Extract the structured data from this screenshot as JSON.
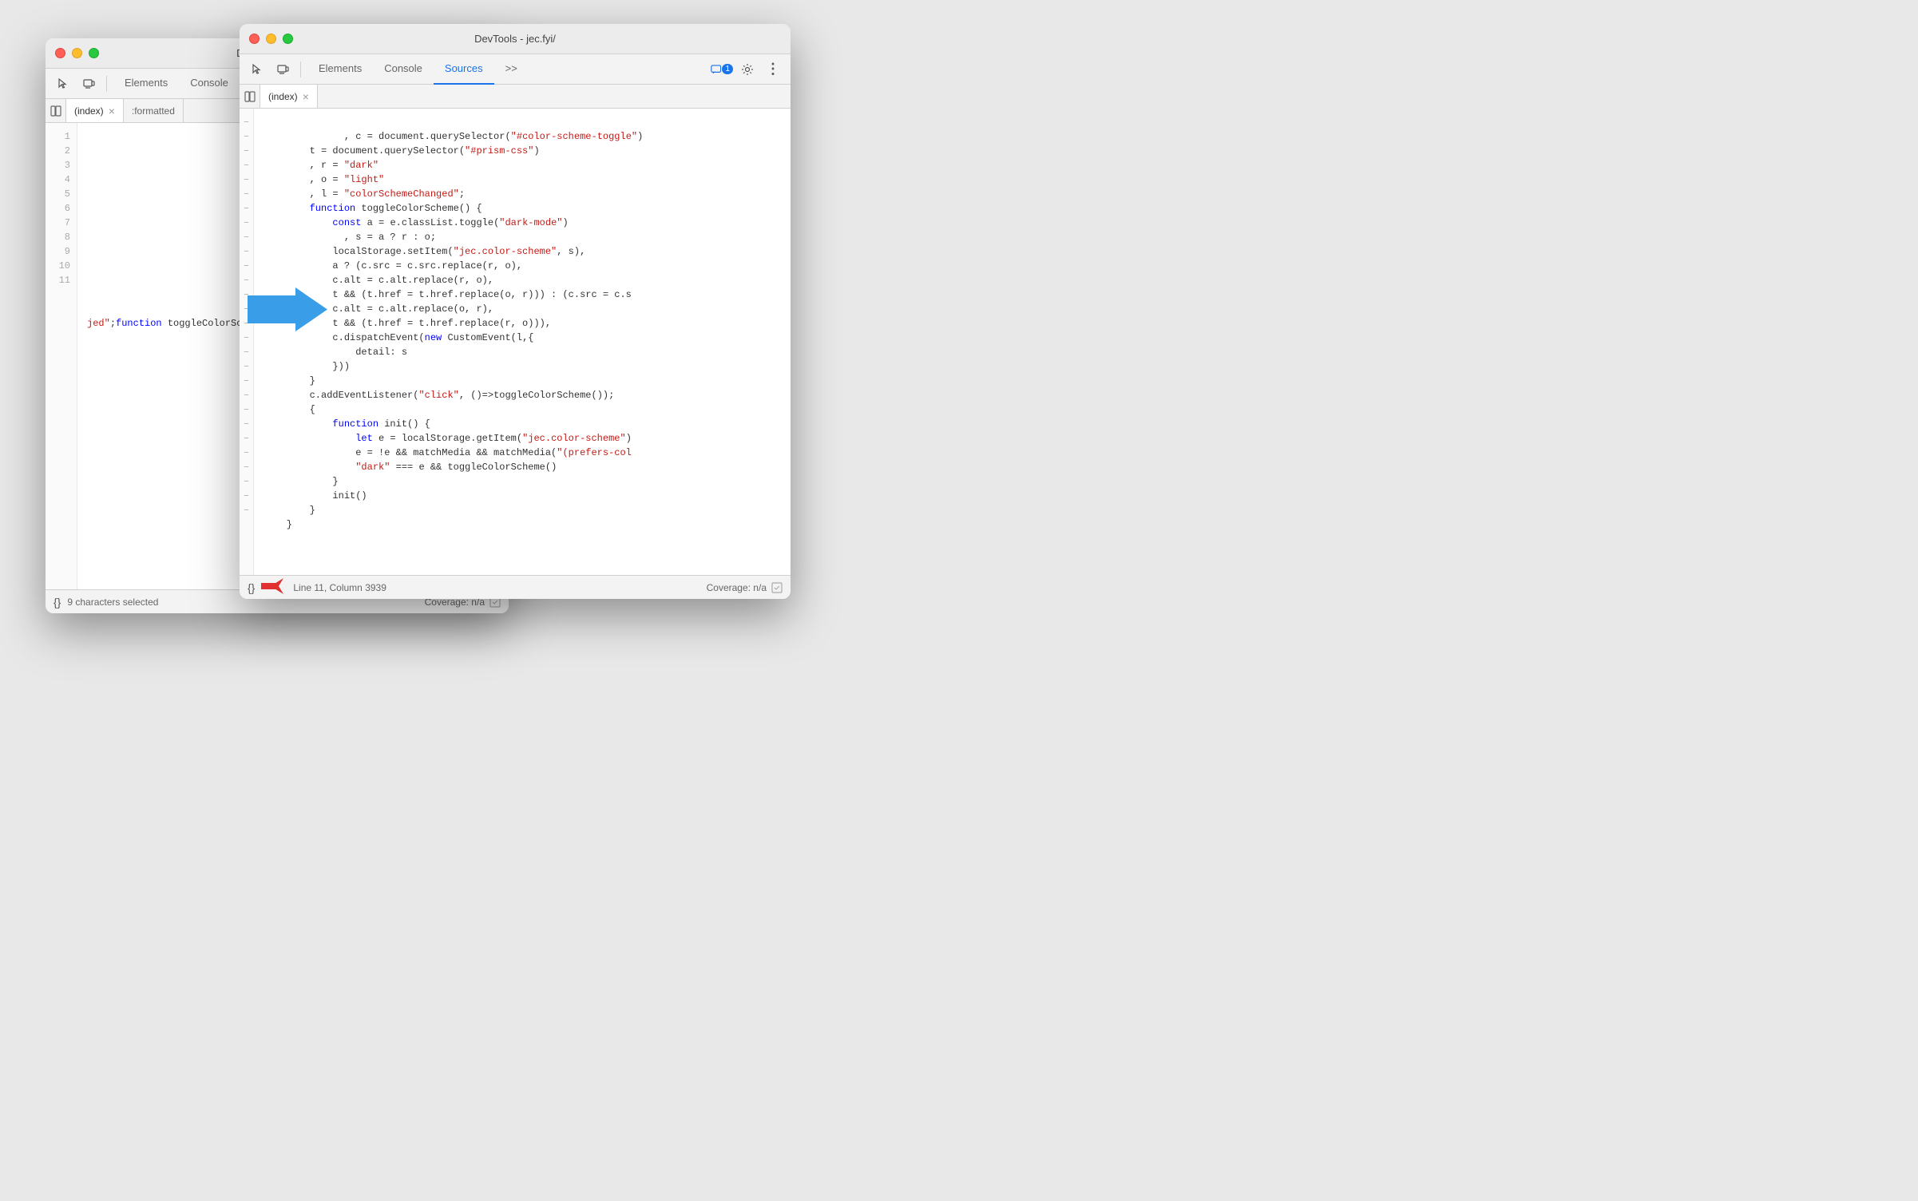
{
  "window1": {
    "title": "DevTools - jec.fyi/",
    "tabs": {
      "elements": "Elements",
      "console": "Console",
      "sources": "Sources",
      "more": ">>"
    },
    "active_tab": "Sources",
    "file_tabs": [
      {
        "name": "(index)",
        "active": true,
        "closeable": true
      },
      {
        "name": ":formatted",
        "active": false,
        "closeable": false
      }
    ],
    "status_bar": {
      "format_label": "{}",
      "status_text": "9 characters selected",
      "coverage_label": "Coverage: n/a"
    },
    "code": {
      "line_numbers": [
        "1",
        "2",
        "3",
        "4",
        "5",
        "6",
        "7",
        "8",
        "9",
        "10",
        "11"
      ],
      "line11_content": "jed\";function toggleColorScheme(){const a=e"
    }
  },
  "window2": {
    "title": "DevTools - jec.fyi/",
    "tabs": {
      "elements": "Elements",
      "console": "Console",
      "sources": "Sources",
      "more": ">>"
    },
    "active_tab": "Sources",
    "file_tabs": [
      {
        "name": "(index)",
        "active": true,
        "closeable": true
      }
    ],
    "badge": "1",
    "status_bar": {
      "format_label": "{}",
      "position_text": "Line 11, Column 3939",
      "coverage_label": "Coverage: n/a"
    },
    "code_lines": [
      {
        "gutter": "-",
        "content": "        , c = document.querySelector(\"#color-scheme-toggle\")"
      },
      {
        "gutter": "-",
        "content": "        t = document.querySelector(\"#prism-css\")"
      },
      {
        "gutter": "-",
        "content": "        , r = \"dark\""
      },
      {
        "gutter": "-",
        "content": "        , o = \"light\""
      },
      {
        "gutter": "-",
        "content": "        , l = \"colorSchemeChanged\";"
      },
      {
        "gutter": "-",
        "content": "        function toggleColorScheme() {"
      },
      {
        "gutter": "-",
        "content": "            const a = e.classList.toggle(\"dark-mode\")"
      },
      {
        "gutter": "-",
        "content": "              , s = a ? r : o;"
      },
      {
        "gutter": "-",
        "content": "            localStorage.setItem(\"jec.color-scheme\", s),"
      },
      {
        "gutter": "-",
        "content": "            a ? (c.src = c.src.replace(r, o),"
      },
      {
        "gutter": "-",
        "content": "            c.alt = c.alt.replace(r, o),"
      },
      {
        "gutter": "-",
        "content": "            t && (t.href = t.href.replace(o, r))) : (c.src = c.s"
      },
      {
        "gutter": "-",
        "content": "            c.alt = c.alt.replace(o, r),"
      },
      {
        "gutter": "-",
        "content": "            t && (t.href = t.href.replace(r, o))),"
      },
      {
        "gutter": "-",
        "content": "            c.dispatchEvent(new CustomEvent(l,{"
      },
      {
        "gutter": "-",
        "content": "                detail: s"
      },
      {
        "gutter": "-",
        "content": "            }))"
      },
      {
        "gutter": "-",
        "content": "        }"
      },
      {
        "gutter": "-",
        "content": "        c.addEventListener(\"click\", ()=>toggleColorScheme());"
      },
      {
        "gutter": "-",
        "content": "        {"
      },
      {
        "gutter": "-",
        "content": "            function init() {"
      },
      {
        "gutter": "-",
        "content": "                let e = localStorage.getItem(\"jec.color-scheme\")"
      },
      {
        "gutter": "-",
        "content": "                e = !e && matchMedia && matchMedia(\"(prefers-col"
      },
      {
        "gutter": "-",
        "content": "                \"dark\" === e && toggleColorScheme()"
      },
      {
        "gutter": "-",
        "content": "            }"
      },
      {
        "gutter": "-",
        "content": "            init()"
      },
      {
        "gutter": "-",
        "content": "        }"
      },
      {
        "gutter": "-",
        "content": "    }"
      }
    ]
  }
}
